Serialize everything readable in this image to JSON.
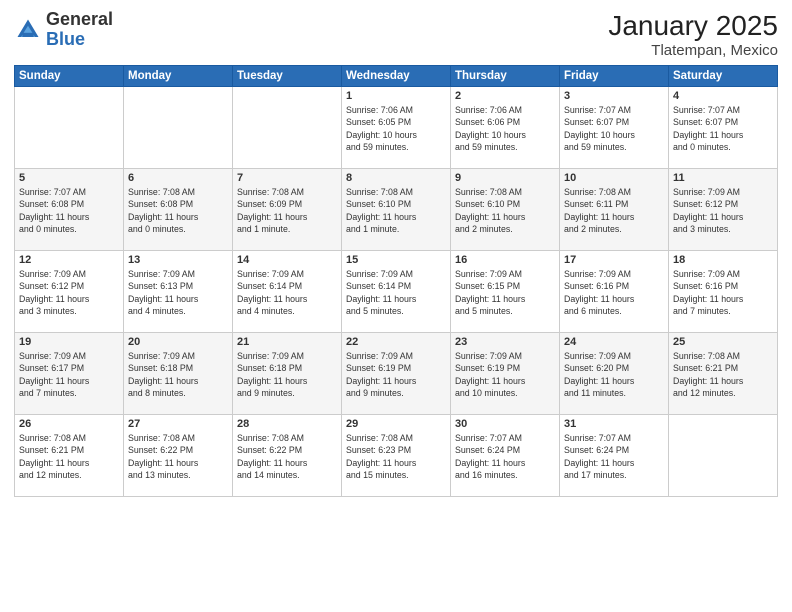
{
  "header": {
    "logo_general": "General",
    "logo_blue": "Blue",
    "month": "January 2025",
    "location": "Tlatempan, Mexico"
  },
  "days_of_week": [
    "Sunday",
    "Monday",
    "Tuesday",
    "Wednesday",
    "Thursday",
    "Friday",
    "Saturday"
  ],
  "weeks": [
    [
      {
        "day": "",
        "info": ""
      },
      {
        "day": "",
        "info": ""
      },
      {
        "day": "",
        "info": ""
      },
      {
        "day": "1",
        "info": "Sunrise: 7:06 AM\nSunset: 6:05 PM\nDaylight: 10 hours\nand 59 minutes."
      },
      {
        "day": "2",
        "info": "Sunrise: 7:06 AM\nSunset: 6:06 PM\nDaylight: 10 hours\nand 59 minutes."
      },
      {
        "day": "3",
        "info": "Sunrise: 7:07 AM\nSunset: 6:07 PM\nDaylight: 10 hours\nand 59 minutes."
      },
      {
        "day": "4",
        "info": "Sunrise: 7:07 AM\nSunset: 6:07 PM\nDaylight: 11 hours\nand 0 minutes."
      }
    ],
    [
      {
        "day": "5",
        "info": "Sunrise: 7:07 AM\nSunset: 6:08 PM\nDaylight: 11 hours\nand 0 minutes."
      },
      {
        "day": "6",
        "info": "Sunrise: 7:08 AM\nSunset: 6:08 PM\nDaylight: 11 hours\nand 0 minutes."
      },
      {
        "day": "7",
        "info": "Sunrise: 7:08 AM\nSunset: 6:09 PM\nDaylight: 11 hours\nand 1 minute."
      },
      {
        "day": "8",
        "info": "Sunrise: 7:08 AM\nSunset: 6:10 PM\nDaylight: 11 hours\nand 1 minute."
      },
      {
        "day": "9",
        "info": "Sunrise: 7:08 AM\nSunset: 6:10 PM\nDaylight: 11 hours\nand 2 minutes."
      },
      {
        "day": "10",
        "info": "Sunrise: 7:08 AM\nSunset: 6:11 PM\nDaylight: 11 hours\nand 2 minutes."
      },
      {
        "day": "11",
        "info": "Sunrise: 7:09 AM\nSunset: 6:12 PM\nDaylight: 11 hours\nand 3 minutes."
      }
    ],
    [
      {
        "day": "12",
        "info": "Sunrise: 7:09 AM\nSunset: 6:12 PM\nDaylight: 11 hours\nand 3 minutes."
      },
      {
        "day": "13",
        "info": "Sunrise: 7:09 AM\nSunset: 6:13 PM\nDaylight: 11 hours\nand 4 minutes."
      },
      {
        "day": "14",
        "info": "Sunrise: 7:09 AM\nSunset: 6:14 PM\nDaylight: 11 hours\nand 4 minutes."
      },
      {
        "day": "15",
        "info": "Sunrise: 7:09 AM\nSunset: 6:14 PM\nDaylight: 11 hours\nand 5 minutes."
      },
      {
        "day": "16",
        "info": "Sunrise: 7:09 AM\nSunset: 6:15 PM\nDaylight: 11 hours\nand 5 minutes."
      },
      {
        "day": "17",
        "info": "Sunrise: 7:09 AM\nSunset: 6:16 PM\nDaylight: 11 hours\nand 6 minutes."
      },
      {
        "day": "18",
        "info": "Sunrise: 7:09 AM\nSunset: 6:16 PM\nDaylight: 11 hours\nand 7 minutes."
      }
    ],
    [
      {
        "day": "19",
        "info": "Sunrise: 7:09 AM\nSunset: 6:17 PM\nDaylight: 11 hours\nand 7 minutes."
      },
      {
        "day": "20",
        "info": "Sunrise: 7:09 AM\nSunset: 6:18 PM\nDaylight: 11 hours\nand 8 minutes."
      },
      {
        "day": "21",
        "info": "Sunrise: 7:09 AM\nSunset: 6:18 PM\nDaylight: 11 hours\nand 9 minutes."
      },
      {
        "day": "22",
        "info": "Sunrise: 7:09 AM\nSunset: 6:19 PM\nDaylight: 11 hours\nand 9 minutes."
      },
      {
        "day": "23",
        "info": "Sunrise: 7:09 AM\nSunset: 6:19 PM\nDaylight: 11 hours\nand 10 minutes."
      },
      {
        "day": "24",
        "info": "Sunrise: 7:09 AM\nSunset: 6:20 PM\nDaylight: 11 hours\nand 11 minutes."
      },
      {
        "day": "25",
        "info": "Sunrise: 7:08 AM\nSunset: 6:21 PM\nDaylight: 11 hours\nand 12 minutes."
      }
    ],
    [
      {
        "day": "26",
        "info": "Sunrise: 7:08 AM\nSunset: 6:21 PM\nDaylight: 11 hours\nand 12 minutes."
      },
      {
        "day": "27",
        "info": "Sunrise: 7:08 AM\nSunset: 6:22 PM\nDaylight: 11 hours\nand 13 minutes."
      },
      {
        "day": "28",
        "info": "Sunrise: 7:08 AM\nSunset: 6:22 PM\nDaylight: 11 hours\nand 14 minutes."
      },
      {
        "day": "29",
        "info": "Sunrise: 7:08 AM\nSunset: 6:23 PM\nDaylight: 11 hours\nand 15 minutes."
      },
      {
        "day": "30",
        "info": "Sunrise: 7:07 AM\nSunset: 6:24 PM\nDaylight: 11 hours\nand 16 minutes."
      },
      {
        "day": "31",
        "info": "Sunrise: 7:07 AM\nSunset: 6:24 PM\nDaylight: 11 hours\nand 17 minutes."
      },
      {
        "day": "",
        "info": ""
      }
    ]
  ]
}
